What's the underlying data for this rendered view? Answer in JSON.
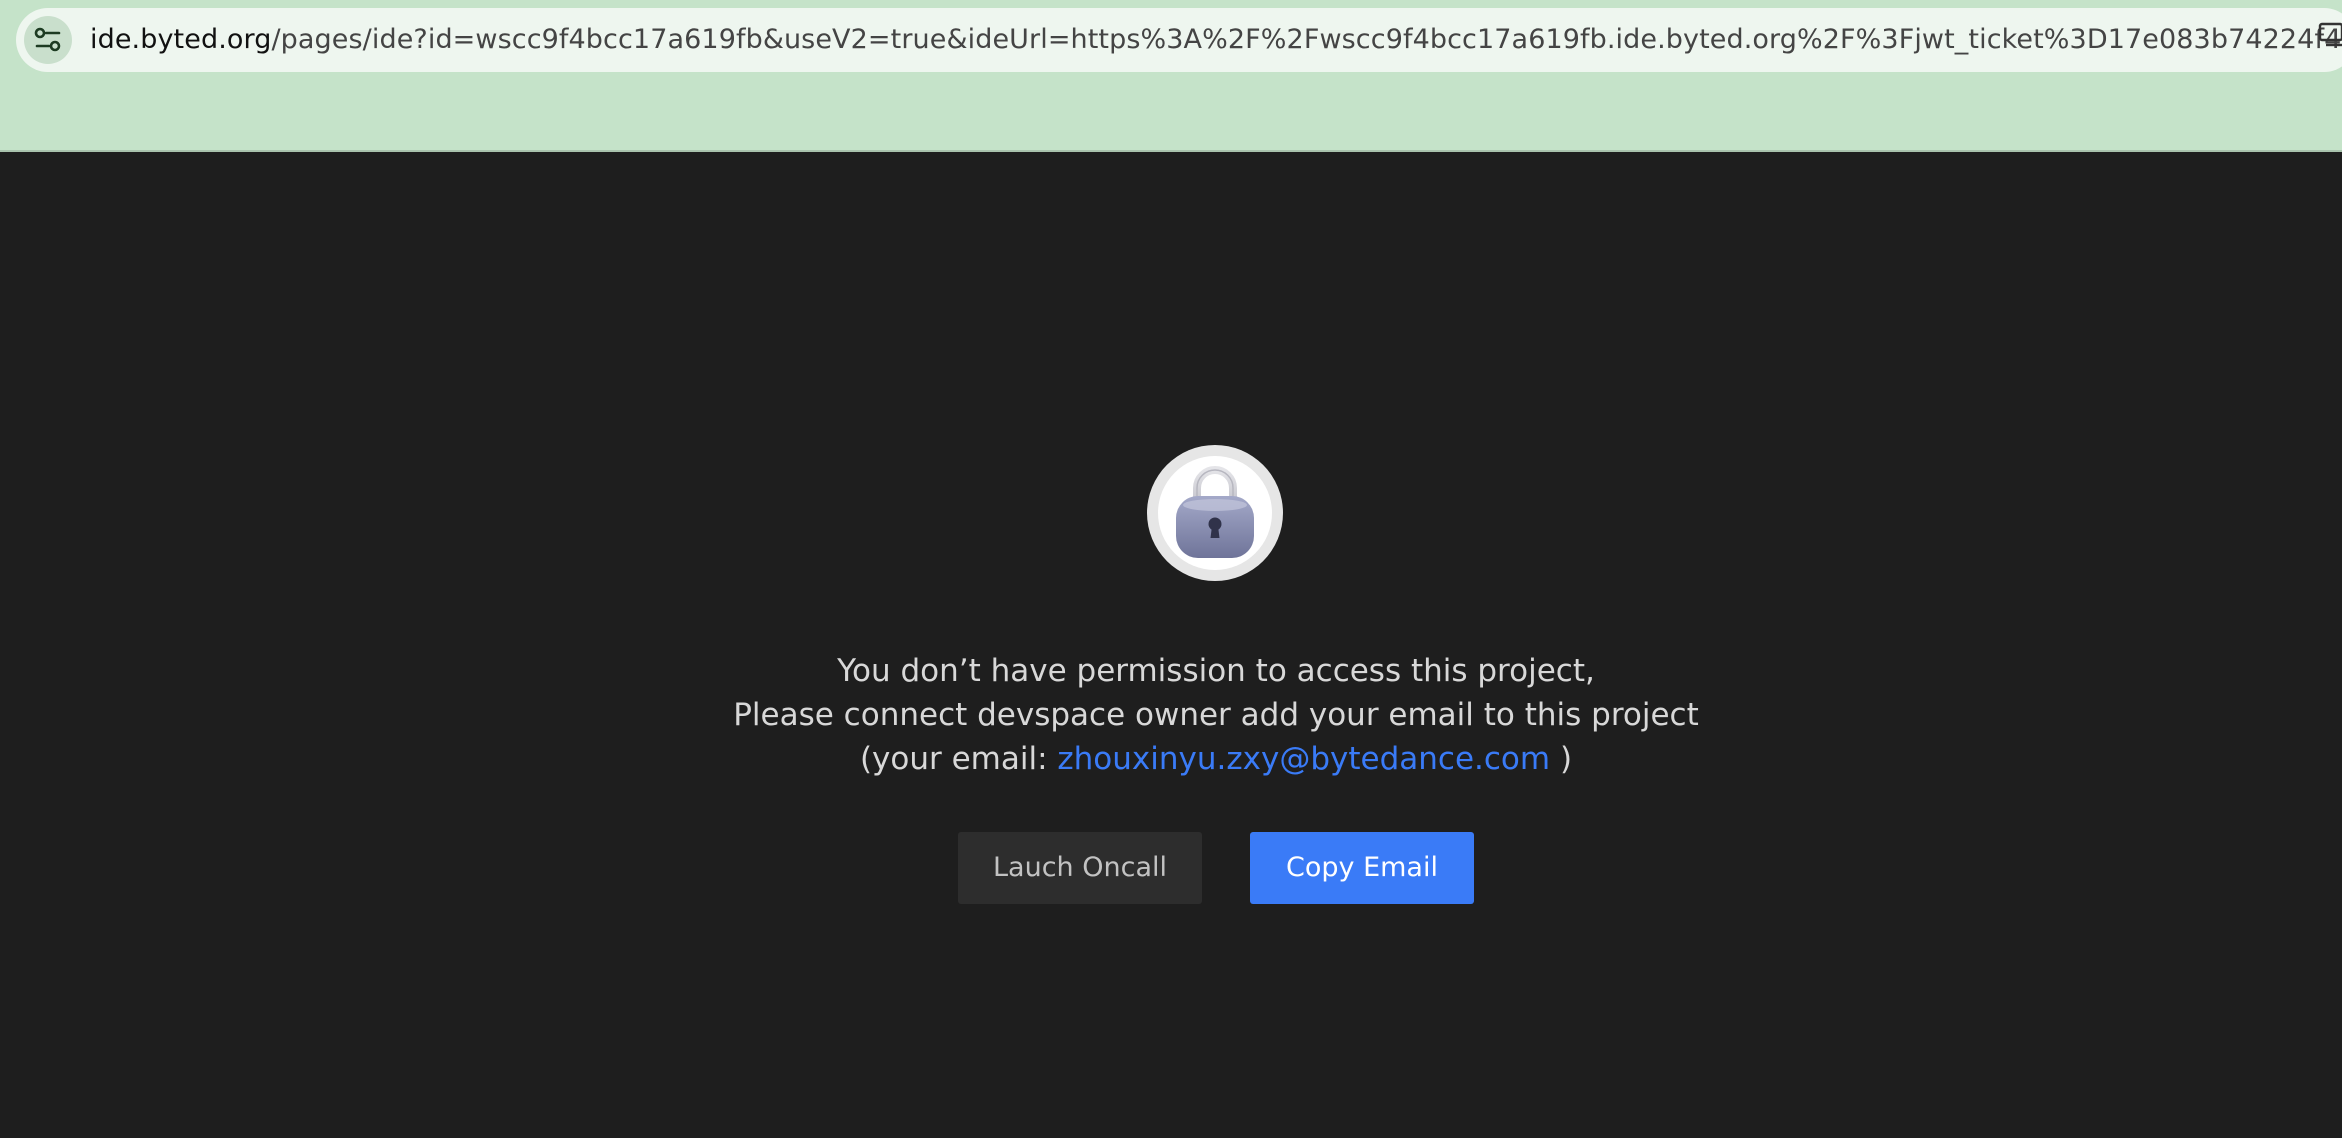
{
  "browser": {
    "url_host": "ide.byted.org",
    "url_path": "/pages/ide?id=wscc9f4bcc17a619fb&useV2=true&ideUrl=https%3A%2F%2Fwscc9f4bcc17a619fb.ide.byted.org%2F%3Fjwt_ticket%3D17e083b74224f4...",
    "settings_icon": "site-settings-icon",
    "right_icon": "screen-icon",
    "bar_color": "#c5e3c9"
  },
  "dialog": {
    "icon": "lock-icon",
    "line1": "You don’t have permission to access this project,",
    "line2": "Please connect devspace owner add your email to this project",
    "line3_prefix": "(your email: ",
    "email": "zhouxinyu.zxy@bytedance.com",
    "line3_suffix": " )",
    "secondary_button": "Lauch Oncall",
    "primary_button": "Copy Email",
    "accent_color": "#3a7bf7",
    "background_color": "#1e1e1e"
  }
}
